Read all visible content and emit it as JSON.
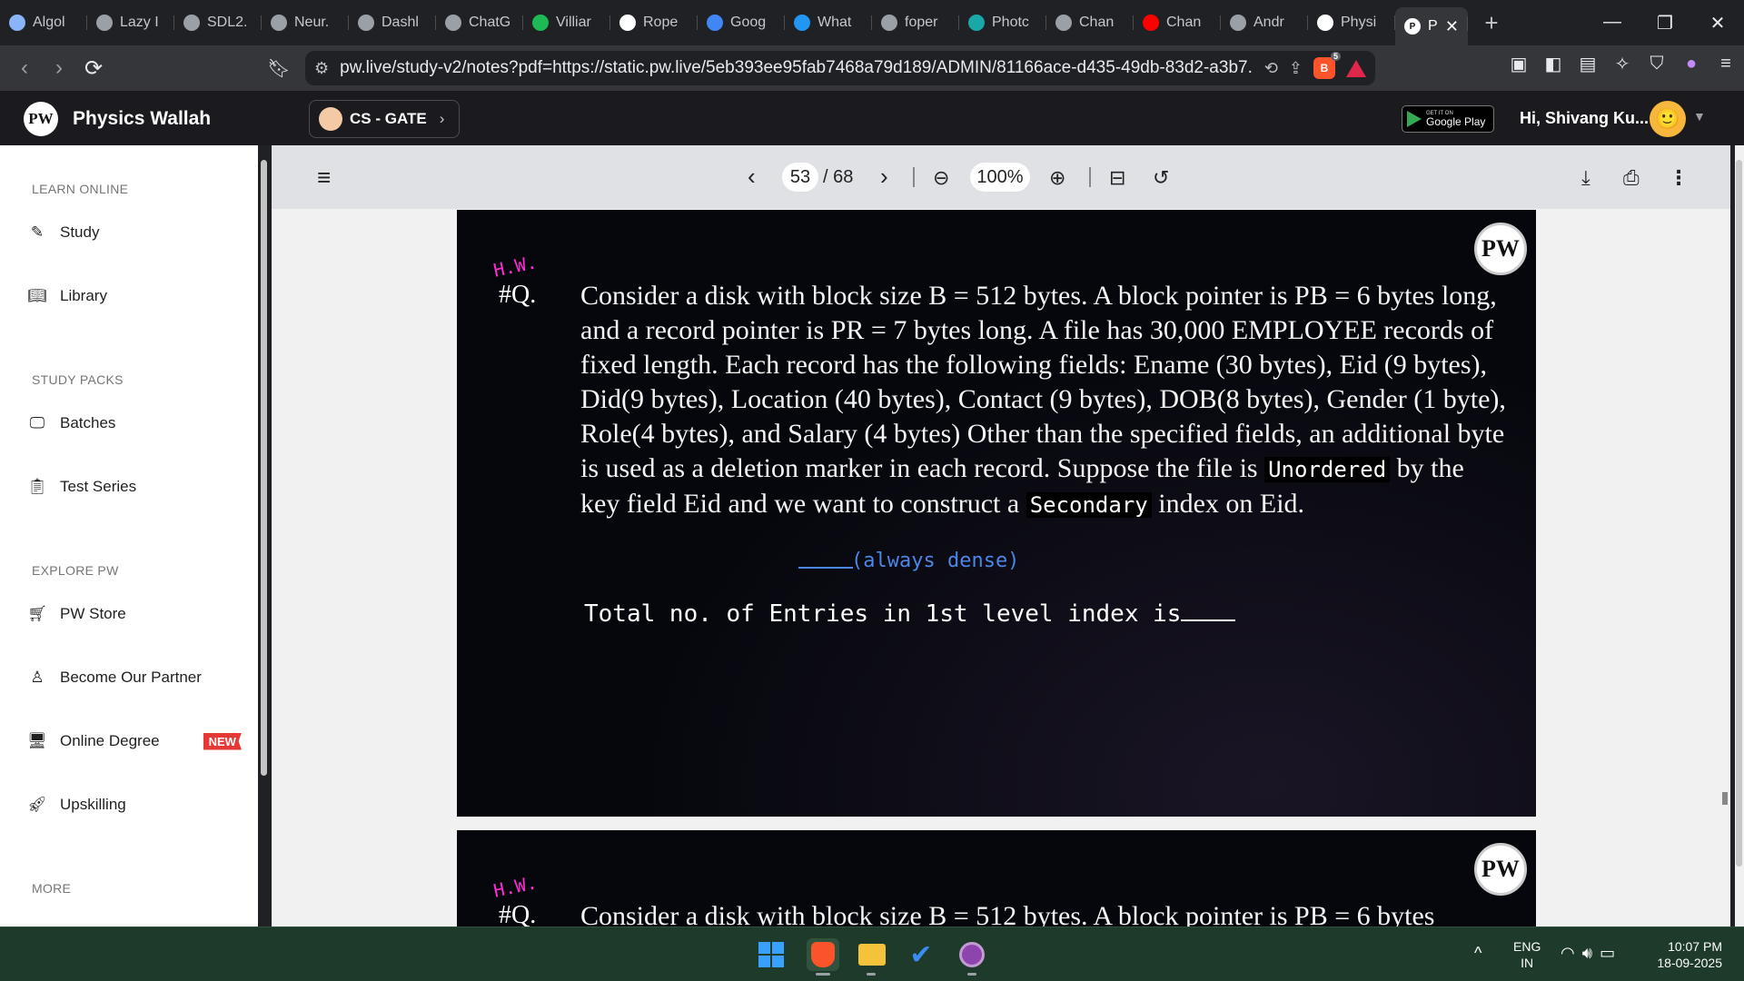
{
  "browser": {
    "tabs": [
      {
        "label": "Algol",
        "icon": "globe-icon",
        "color": "#8ab4f8"
      },
      {
        "label": "Lazy I",
        "icon": "globe-icon",
        "color": "#9aa0a6"
      },
      {
        "label": "SDL2.",
        "icon": "github-icon",
        "color": "#9aa0a6"
      },
      {
        "label": "Neur.",
        "icon": "globe-icon",
        "color": "#9aa0a6"
      },
      {
        "label": "Dashl",
        "icon": "github-icon",
        "color": "#9aa0a6"
      },
      {
        "label": "ChatG",
        "icon": "openai-icon",
        "color": "#9aa0a6"
      },
      {
        "label": "Villiar",
        "icon": "spotify-icon",
        "color": "#1db954"
      },
      {
        "label": "Rope",
        "icon": "wikipedia-icon",
        "color": "#ffffff"
      },
      {
        "label": "Goog",
        "icon": "gemini-icon",
        "color": "#4285f4"
      },
      {
        "label": "What",
        "icon": "orm-icon",
        "color": "#2196f3"
      },
      {
        "label": "foper",
        "icon": "globe-icon",
        "color": "#9aa0a6"
      },
      {
        "label": "Photc",
        "icon": "photo-icon",
        "color": "#1aa7a7"
      },
      {
        "label": "Chan",
        "icon": "globe-icon",
        "color": "#9aa0a6"
      },
      {
        "label": "Chan",
        "icon": "youtube-icon",
        "color": "#ff0000"
      },
      {
        "label": "Andr",
        "icon": "openai-icon",
        "color": "#9aa0a6"
      },
      {
        "label": "Physi",
        "icon": "pw-icon",
        "color": "#ffffff"
      }
    ],
    "active_tab": {
      "label": "P",
      "icon": "pw-icon"
    },
    "new_tab_label": "+",
    "url": "pw.live/study-v2/notes?pdf=https://static.pw.live/5eb393ee95fab7468a79d189/ADMIN/81166ace-d435-49db-83d2-a3b7...",
    "brave_badge": "5"
  },
  "site": {
    "logo_text": "PW",
    "name": "Physics Wallah",
    "batch": "CS - GATE",
    "gplay_small": "GET IT ON",
    "gplay_big": "Google Play",
    "greeting": "Hi, Shivang Ku..."
  },
  "sidebar": {
    "sections": [
      {
        "title": "LEARN ONLINE",
        "items": [
          {
            "label": "Study",
            "icon": "edit-icon"
          },
          {
            "label": "Library",
            "icon": "book-icon"
          }
        ]
      },
      {
        "title": "STUDY PACKS",
        "items": [
          {
            "label": "Batches",
            "icon": "monitor-icon"
          },
          {
            "label": "Test Series",
            "icon": "clipboard-icon"
          }
        ]
      },
      {
        "title": "EXPLORE PW",
        "items": [
          {
            "label": "PW Store",
            "icon": "cart-icon"
          },
          {
            "label": "Become Our Partner",
            "icon": "partner-icon"
          },
          {
            "label": "Online Degree",
            "icon": "degree-icon",
            "badge": "NEW"
          },
          {
            "label": "Upskilling",
            "icon": "rocket-icon"
          }
        ]
      },
      {
        "title": "MORE",
        "items": []
      }
    ]
  },
  "pdf": {
    "current_page": "53",
    "total_pages": "/ 68",
    "zoom": "100%",
    "hw_label": "H.W.",
    "q_label": "#Q.",
    "question": "Consider a disk with block size B = 512 bytes. A block pointer is PB = 6 bytes long, and a record pointer is PR = 7 bytes long. A file has 30,000 EMPLOYEE records of fixed length. Each record has the following fields: Ename (30 bytes), Eid (9 bytes), Did(9 bytes), Location (40 bytes), Contact (9 bytes), DOB(8 bytes), Gender (1 byte), Role(4 bytes), and Salary (4 bytes) Other than the specified fields, an additional byte is used as a deletion  marker in each record. Suppose the file is",
    "q_part2": "by the  key field Eid   and we want to construct a",
    "q_part3": "index on Eid.",
    "hand_unordered": "Unordered",
    "hand_secondary": "Secondary",
    "hand_note": "(always dense)",
    "hand_total": "Total no. of Entries in 1st level index is",
    "page2_question": "Consider a disk with block size B = 512 bytes. A block pointer is PB = 6 bytes"
  },
  "taskbar": {
    "lang_line1": "ENG",
    "lang_line2": "IN",
    "time": "10:07 PM",
    "date": "18-09-2025"
  }
}
